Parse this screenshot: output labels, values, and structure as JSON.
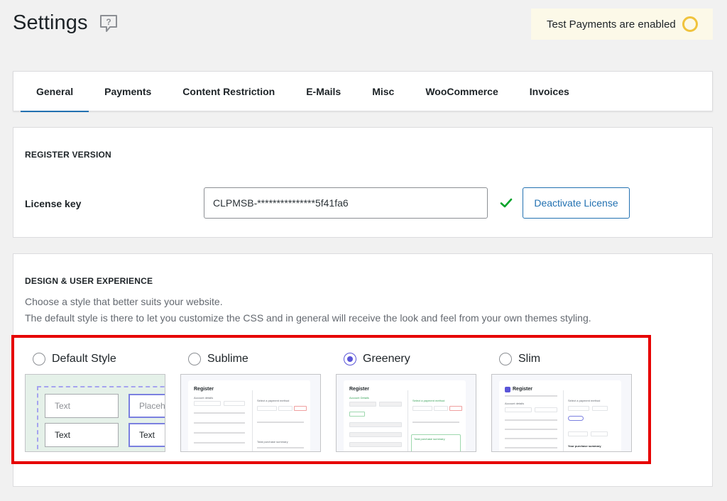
{
  "header": {
    "title": "Settings",
    "help_icon": "chat-question-icon"
  },
  "notice": {
    "text": "Test Payments are enabled",
    "indicator_color": "#f0c33c",
    "background": "#fcf9e8"
  },
  "tabs": [
    {
      "label": "General",
      "active": true
    },
    {
      "label": "Payments",
      "active": false
    },
    {
      "label": "Content Restriction",
      "active": false
    },
    {
      "label": "E-Mails",
      "active": false
    },
    {
      "label": "Misc",
      "active": false
    },
    {
      "label": "WooCommerce",
      "active": false
    },
    {
      "label": "Invoices",
      "active": false
    }
  ],
  "register": {
    "title": "REGISTER VERSION",
    "license_label": "License key",
    "license_value": "CLPMSB-***************5f41fa6",
    "valid_icon": "check-icon",
    "deactivate_label": "Deactivate License"
  },
  "design": {
    "title": "DESIGN & USER EXPERIENCE",
    "desc1": "Choose a style that better suits your website.",
    "desc2": "The default style is there to let you customize the CSS and in general will receive the look and feel from your own themes styling.",
    "styles": [
      {
        "label": "Default Style",
        "selected": false
      },
      {
        "label": "Sublime",
        "selected": false
      },
      {
        "label": "Greenery",
        "selected": true
      },
      {
        "label": "Slim",
        "selected": false
      }
    ],
    "default_preview": {
      "field1": "Text",
      "field2": "Placeholder",
      "field3": "Text",
      "field4": "Text"
    },
    "previews": {
      "sublime": {
        "heading": "Register",
        "section": "Account details",
        "side": "Select a payment method",
        "summary": "Total purchase summary"
      },
      "greenery": {
        "heading": "Register",
        "section": "Account Details",
        "side": "Select a payment method",
        "summary": "Total purchase summary"
      },
      "slim": {
        "heading": "Register",
        "section": "Account details",
        "side": "Select a payment method",
        "summary": "Your purchase summary"
      }
    },
    "highlight_color": "#e60000",
    "accent_color": "#5a55d8"
  }
}
